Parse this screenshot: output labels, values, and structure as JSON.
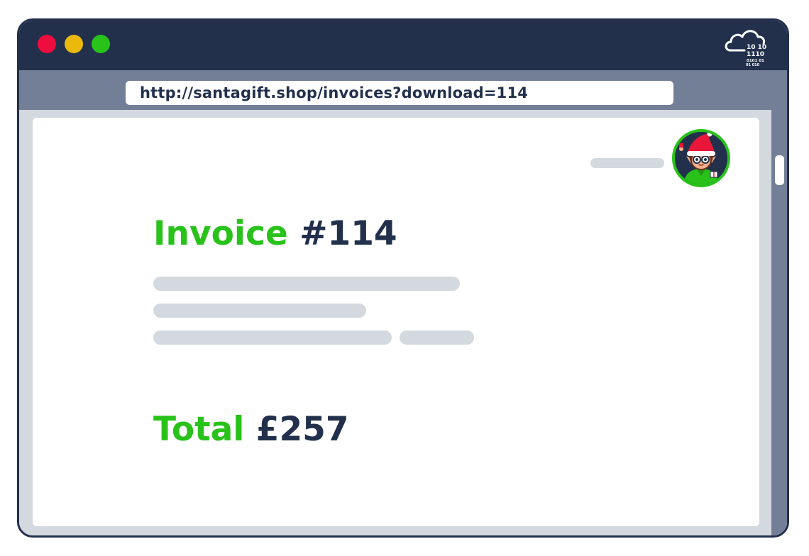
{
  "window": {
    "controls": [
      "close",
      "minimize",
      "maximize"
    ],
    "logo_icon": "cloud-binary-icon",
    "logo_digits": [
      "10 10",
      "1110",
      "0101 01",
      "01 010"
    ]
  },
  "address_bar": {
    "url": "http://santagift.shop/invoices?download=114"
  },
  "invoice": {
    "title_label": "Invoice",
    "title_number": "#114",
    "total_label": "Total",
    "total_value": "£257"
  },
  "colors": {
    "titlebar": "#22304c",
    "addressbar": "#737f97",
    "accent_green": "#29c21a",
    "dark_text": "#22304c",
    "placeholder": "#d3d9df",
    "close": "#ee0d3c",
    "minimize": "#ebb90b",
    "maximize": "#29c21a"
  }
}
